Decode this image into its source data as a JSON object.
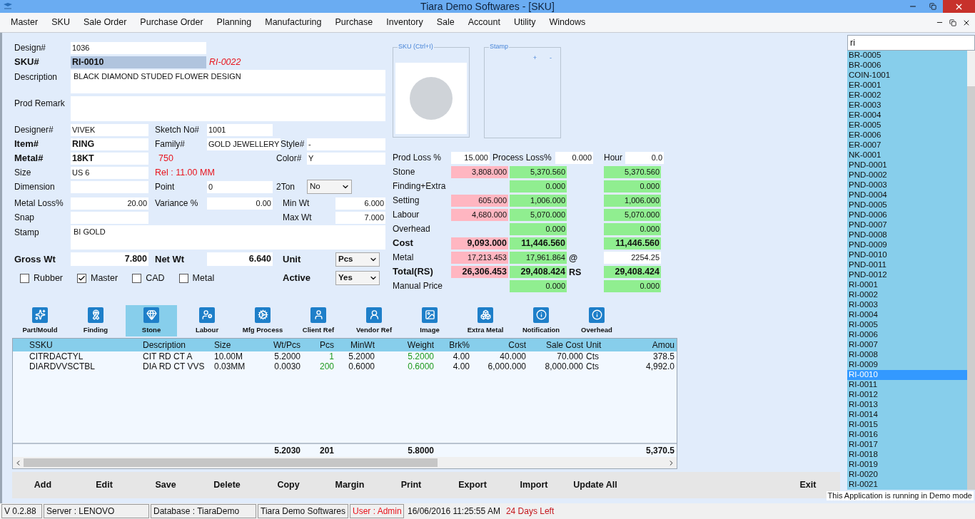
{
  "window": {
    "title": "Tiara Demo Softwares - [SKU]"
  },
  "menu": [
    "Master",
    "SKU",
    "Sale Order",
    "Purchase Order",
    "Planning",
    "Manufacturing",
    "Purchase",
    "Inventory",
    "Sale",
    "Account",
    "Utility",
    "Windows"
  ],
  "form": {
    "design": {
      "label": "Design#",
      "value": "1036"
    },
    "sku": {
      "label": "SKU#",
      "value": "RI-0010",
      "next": "RI-0022"
    },
    "description": {
      "label": "Description",
      "value": "BLACK DIAMOND STUDED FLOWER DESIGN"
    },
    "prod_remark": {
      "label": "Prod Remark"
    },
    "designer": {
      "label": "Designer#",
      "value": "VIVEK"
    },
    "sketch": {
      "label": "Sketch No#",
      "value": "1001"
    },
    "item": {
      "label": "Item#",
      "value": "RING"
    },
    "family": {
      "label": "Family#",
      "value": "GOLD JEWELLERY"
    },
    "style": {
      "label": "Style#",
      "value": "-"
    },
    "metal": {
      "label": "Metal#",
      "value": "18KT"
    },
    "purity": "750",
    "color": {
      "label": "Color#",
      "value": "Y"
    },
    "size": {
      "label": "Size",
      "value": "US 6"
    },
    "rel": "Rel : 11.00 MM",
    "dimension": {
      "label": "Dimension"
    },
    "point": {
      "label": "Point",
      "value": "0"
    },
    "two_ton": {
      "label": "2Ton",
      "value": "No"
    },
    "metal_loss": {
      "label": "Metal Loss%",
      "value": "20.00"
    },
    "variance": {
      "label": "Variance %",
      "value": "0.00"
    },
    "min_wt": {
      "label": "Min Wt",
      "value": "6.000"
    },
    "snap": {
      "label": "Snap"
    },
    "max_wt": {
      "label": "Max Wt",
      "value": "7.000"
    },
    "stamp": {
      "label": "Stamp",
      "value": "BI GOLD"
    },
    "gross_wt": {
      "label": "Gross Wt",
      "value": "7.800"
    },
    "net_wt": {
      "label": "Net Wt",
      "value": "6.640"
    },
    "unit": {
      "label": "Unit",
      "value": "Pcs"
    },
    "active": {
      "label": "Active",
      "value": "Yes"
    },
    "checkboxes": [
      {
        "label": "Rubber",
        "checked": false
      },
      {
        "label": "Master",
        "checked": true
      },
      {
        "label": "CAD",
        "checked": false
      },
      {
        "label": "Metal",
        "checked": false
      }
    ]
  },
  "image_panel": {
    "title": "SKU (Ctrl+I)"
  },
  "stamp_panel": {
    "title": "Stamp",
    "add": "+",
    "remove": "-"
  },
  "costing": {
    "prod_loss": {
      "label": "Prod Loss  %",
      "value": "15.000"
    },
    "process_loss": {
      "label": "Process Loss%",
      "value": "0.000"
    },
    "hour": {
      "label": "Hour",
      "value": "0.0"
    },
    "rows": [
      {
        "label": "Stone",
        "bold": false,
        "col_1": "3,808.000",
        "col_2": "5,370.560",
        "col_3": "5,370.560",
        "col_3_editable": false
      },
      {
        "label": "Finding+Extra",
        "bold": false,
        "col_2": "0.000",
        "col_3": "0.000",
        "col_3_editable": false
      },
      {
        "label": "Setting",
        "bold": false,
        "col_1": "605.000",
        "col_2": "1,006.000",
        "col_3": "1,006.000",
        "col_3_editable": false
      },
      {
        "label": "Labour",
        "bold": false,
        "col_1": "4,680.000",
        "col_2": "5,070.000",
        "col_3": "5,070.000",
        "col_3_editable": false
      },
      {
        "label": "Overhead",
        "bold": false,
        "col_2": "0.000",
        "col_3": "0.000",
        "col_3_editable": false
      },
      {
        "label": "Cost",
        "bold": true,
        "col_1": "9,093.000",
        "col_2": "11,446.560",
        "col_3": "11,446.560",
        "col_3_editable": false
      },
      {
        "label": "Metal",
        "bold": false,
        "col_1": "17,213.453",
        "col_2": "17,961.864",
        "mark": "@",
        "col_3": "2254.25",
        "col_3_editable": true
      },
      {
        "label": "Total(RS)",
        "bold": true,
        "col_1": "26,306.453",
        "col_2": "29,408.424",
        "mark": "RS",
        "col_3": "29,408.424",
        "col_3_editable": false
      },
      {
        "label": "Manual Price",
        "bold": false,
        "col_2": "0.000",
        "col_3": "0.000",
        "col_3_editable": false
      }
    ]
  },
  "tabs": [
    {
      "label": "Part/Mould",
      "selected": false
    },
    {
      "label": "Finding",
      "selected": false
    },
    {
      "label": "Stone",
      "selected": true
    },
    {
      "label": "Labour",
      "selected": false
    },
    {
      "label": "Mfg Process",
      "selected": false
    },
    {
      "label": "Client Ref",
      "selected": false
    },
    {
      "label": "Vendor Ref",
      "selected": false
    },
    {
      "label": "Image",
      "selected": false
    },
    {
      "label": "Extra Metal",
      "selected": false
    },
    {
      "label": "Notification",
      "selected": false
    },
    {
      "label": "Overhead",
      "selected": false
    }
  ],
  "table": {
    "columns": [
      {
        "label": "SSKU",
        "kind": "text",
        "highlight": false
      },
      {
        "label": "Description",
        "kind": "text",
        "highlight": false
      },
      {
        "label": "Size",
        "kind": "text",
        "highlight": false
      },
      {
        "label": "Wt/Pcs",
        "kind": "number",
        "highlight": false,
        "total": "5.2030"
      },
      {
        "label": "Pcs",
        "kind": "number",
        "highlight": true,
        "total": "201"
      },
      {
        "label": "MinWt",
        "kind": "number",
        "highlight": false
      },
      {
        "label": "Weight",
        "kind": "number",
        "highlight": true,
        "total": "5.8000"
      },
      {
        "label": "Brk%",
        "kind": "number",
        "highlight": false
      },
      {
        "label": "Cost",
        "kind": "number",
        "highlight": false
      },
      {
        "label": "Sale Cost",
        "kind": "number",
        "highlight": false
      },
      {
        "label": "Unit",
        "kind": "text",
        "highlight": false
      },
      {
        "label": "Amou",
        "kind": "number",
        "highlight": false,
        "total": "5,370.5"
      }
    ],
    "rows": [
      [
        "CITRDACTYL",
        "CIT RD CT A",
        "10.00M",
        "5.2000",
        "1",
        "5.2000",
        "5.2000",
        "4.00",
        "40.000",
        "70.000",
        "Cts",
        "378.5"
      ],
      [
        "DIARDVVSCTBL",
        "DIA RD CT VVS",
        "0.03MM",
        "0.0030",
        "200",
        "0.6000",
        "0.6000",
        "4.00",
        "6,000.000",
        "8,000.000",
        "Cts",
        "4,992.0"
      ]
    ]
  },
  "buttons": [
    "Add",
    "Edit",
    "Save",
    "Delete",
    "Copy",
    "Margin",
    "Print",
    "Export",
    "Import",
    "Update All",
    "Exit"
  ],
  "sku_list": {
    "search": "ri",
    "items": [
      {
        "label": "BR-0005",
        "selected": false
      },
      {
        "label": "BR-0006",
        "selected": false
      },
      {
        "label": "COIN-1001",
        "selected": false
      },
      {
        "label": "ER-0001",
        "selected": false
      },
      {
        "label": "ER-0002",
        "selected": false
      },
      {
        "label": "ER-0003",
        "selected": false
      },
      {
        "label": "ER-0004",
        "selected": false
      },
      {
        "label": "ER-0005",
        "selected": false
      },
      {
        "label": "ER-0006",
        "selected": false
      },
      {
        "label": "ER-0007",
        "selected": false
      },
      {
        "label": "NK-0001",
        "selected": false
      },
      {
        "label": "PND-0001",
        "selected": false
      },
      {
        "label": "PND-0002",
        "selected": false
      },
      {
        "label": "PND-0003",
        "selected": false
      },
      {
        "label": "PND-0004",
        "selected": false
      },
      {
        "label": "PND-0005",
        "selected": false
      },
      {
        "label": "PND-0006",
        "selected": false
      },
      {
        "label": "PND-0007",
        "selected": false
      },
      {
        "label": "PND-0008",
        "selected": false
      },
      {
        "label": "PND-0009",
        "selected": false
      },
      {
        "label": "PND-0010",
        "selected": false
      },
      {
        "label": "PND-0011",
        "selected": false
      },
      {
        "label": "PND-0012",
        "selected": false
      },
      {
        "label": "RI-0001",
        "selected": false
      },
      {
        "label": "RI-0002",
        "selected": false
      },
      {
        "label": "RI-0003",
        "selected": false
      },
      {
        "label": "RI-0004",
        "selected": false
      },
      {
        "label": "RI-0005",
        "selected": false
      },
      {
        "label": "RI-0006",
        "selected": false
      },
      {
        "label": "RI-0007",
        "selected": false
      },
      {
        "label": "RI-0008",
        "selected": false
      },
      {
        "label": "RI-0009",
        "selected": false
      },
      {
        "label": "RI-0010",
        "selected": true
      },
      {
        "label": "RI-0011",
        "selected": false
      },
      {
        "label": "RI-0012",
        "selected": false
      },
      {
        "label": "RI-0013",
        "selected": false
      },
      {
        "label": "RI-0014",
        "selected": false
      },
      {
        "label": "RI-0015",
        "selected": false
      },
      {
        "label": "RI-0016",
        "selected": false
      },
      {
        "label": "RI-0017",
        "selected": false
      },
      {
        "label": "RI-0018",
        "selected": false
      },
      {
        "label": "RI-0019",
        "selected": false
      },
      {
        "label": "RI-0020",
        "selected": false
      },
      {
        "label": "RI-0021",
        "selected": false
      }
    ]
  },
  "demo_notice": "This Application is running in Demo mode",
  "status_bar": {
    "version": "V 0.2.88",
    "server": "Server : LENOVO",
    "database": "Database : TiaraDemo",
    "company": "Tiara Demo Softwares",
    "user": "User : Admin",
    "datetime": "16/06/2016 11:25:55 AM",
    "days_left": "24 Days Left"
  }
}
